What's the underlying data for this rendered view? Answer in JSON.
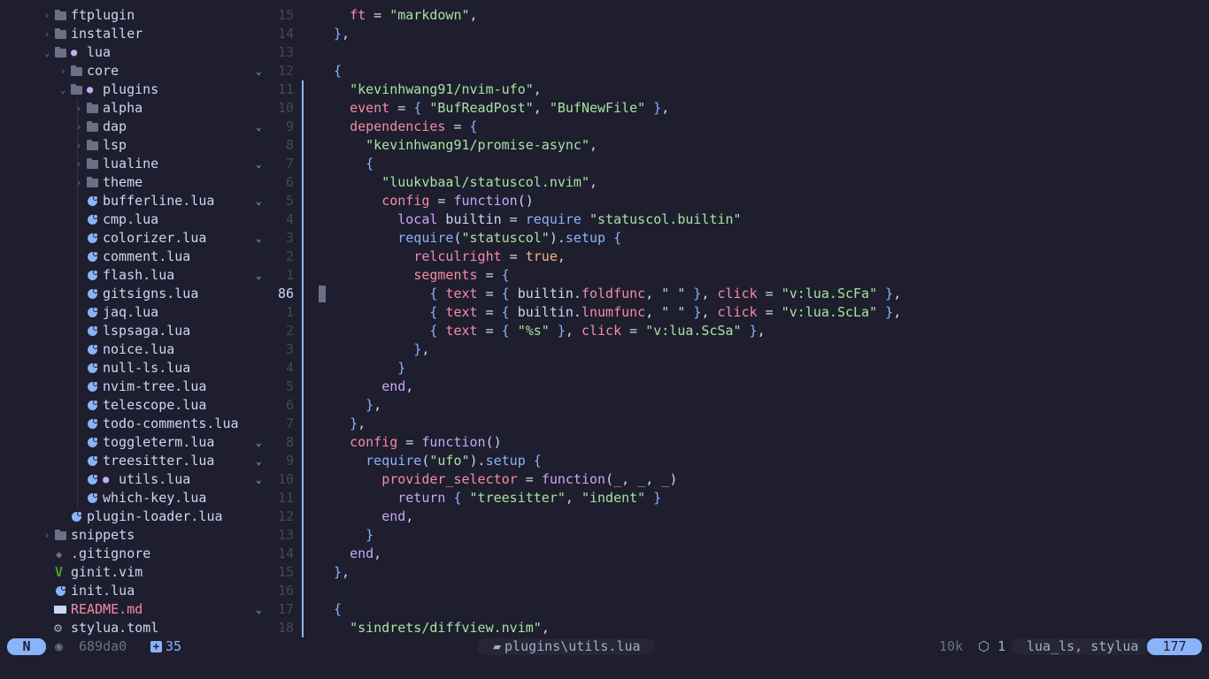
{
  "tree": [
    {
      "name": "ftplugin",
      "type": "folder",
      "depth": 0,
      "open": false,
      "ln": "15"
    },
    {
      "name": "installer",
      "type": "folder",
      "depth": 0,
      "open": false,
      "ln": "14"
    },
    {
      "name": "lua",
      "type": "folder",
      "depth": 0,
      "open": true,
      "modified": true,
      "ln": "13"
    },
    {
      "name": "core",
      "type": "folder",
      "depth": 1,
      "open": false,
      "fold": true,
      "ln": "12"
    },
    {
      "name": "plugins",
      "type": "folder",
      "depth": 1,
      "open": true,
      "modified": true,
      "ln": "11"
    },
    {
      "name": "alpha",
      "type": "folder",
      "depth": 2,
      "open": false,
      "ln": "10"
    },
    {
      "name": "dap",
      "type": "folder",
      "depth": 2,
      "open": false,
      "fold": true,
      "ln": "9"
    },
    {
      "name": "lsp",
      "type": "folder",
      "depth": 2,
      "open": false,
      "ln": "8"
    },
    {
      "name": "lualine",
      "type": "folder",
      "depth": 2,
      "open": false,
      "fold": true,
      "ln": "7"
    },
    {
      "name": "theme",
      "type": "folder",
      "depth": 2,
      "open": false,
      "ln": "6"
    },
    {
      "name": "bufferline.lua",
      "type": "lua",
      "depth": 2,
      "fold": true,
      "ln": "5"
    },
    {
      "name": "cmp.lua",
      "type": "lua",
      "depth": 2,
      "ln": "4"
    },
    {
      "name": "colorizer.lua",
      "type": "lua",
      "depth": 2,
      "fold": true,
      "ln": "3"
    },
    {
      "name": "comment.lua",
      "type": "lua",
      "depth": 2,
      "ln": "2"
    },
    {
      "name": "flash.lua",
      "type": "lua",
      "depth": 2,
      "fold": true,
      "ln": "1"
    },
    {
      "name": "gitsigns.lua",
      "type": "lua",
      "depth": 2,
      "ln": "86",
      "current": true
    },
    {
      "name": "jaq.lua",
      "type": "lua",
      "depth": 2,
      "ln": "1"
    },
    {
      "name": "lspsaga.lua",
      "type": "lua",
      "depth": 2,
      "ln": "2"
    },
    {
      "name": "noice.lua",
      "type": "lua",
      "depth": 2,
      "ln": "3"
    },
    {
      "name": "null-ls.lua",
      "type": "lua",
      "depth": 2,
      "ln": "4"
    },
    {
      "name": "nvim-tree.lua",
      "type": "lua",
      "depth": 2,
      "ln": "5"
    },
    {
      "name": "telescope.lua",
      "type": "lua",
      "depth": 2,
      "ln": "6"
    },
    {
      "name": "todo-comments.lua",
      "type": "lua",
      "depth": 2,
      "ln": "7"
    },
    {
      "name": "toggleterm.lua",
      "type": "lua",
      "depth": 2,
      "fold": true,
      "ln": "8"
    },
    {
      "name": "treesitter.lua",
      "type": "lua",
      "depth": 2,
      "fold": true,
      "ln": "9"
    },
    {
      "name": "utils.lua",
      "type": "lua",
      "depth": 2,
      "modified": true,
      "fold": true,
      "ln": "10"
    },
    {
      "name": "which-key.lua",
      "type": "lua",
      "depth": 2,
      "ln": "11"
    },
    {
      "name": "plugin-loader.lua",
      "type": "lua",
      "depth": 1,
      "ln": "12"
    },
    {
      "name": "snippets",
      "type": "folder",
      "depth": 0,
      "open": false,
      "ln": "13"
    },
    {
      "name": ".gitignore",
      "type": "git",
      "depth": 0,
      "ln": "14"
    },
    {
      "name": "ginit.vim",
      "type": "vim",
      "depth": 0,
      "ln": "15"
    },
    {
      "name": "init.lua",
      "type": "lua",
      "depth": 0,
      "ln": "16"
    },
    {
      "name": "README.md",
      "type": "md",
      "depth": 0,
      "fold": true,
      "ln": "17"
    },
    {
      "name": "stylua.toml",
      "type": "toml",
      "depth": 0,
      "ln": "18"
    }
  ],
  "code": [
    [
      [
        "  ",
        "p"
      ],
      [
        "ft",
        "k"
      ],
      [
        " = ",
        "p"
      ],
      [
        "\"markdown\"",
        "s"
      ],
      [
        ",",
        "p"
      ]
    ],
    [
      [
        "}",
        "b"
      ],
      [
        ",",
        "p"
      ]
    ],
    [],
    [
      [
        "{",
        "b"
      ]
    ],
    [
      [
        "  ",
        "p"
      ],
      [
        "\"kevinhwang91/nvim-ufo\"",
        "s"
      ],
      [
        ",",
        "p"
      ]
    ],
    [
      [
        "  ",
        "p"
      ],
      [
        "event",
        "k"
      ],
      [
        " = ",
        "p"
      ],
      [
        "{",
        "b"
      ],
      [
        " ",
        "p"
      ],
      [
        "\"BufReadPost\"",
        "s"
      ],
      [
        ", ",
        "p"
      ],
      [
        "\"BufNewFile\"",
        "s"
      ],
      [
        " ",
        "p"
      ],
      [
        "}",
        "b"
      ],
      [
        ",",
        "p"
      ]
    ],
    [
      [
        "  ",
        "p"
      ],
      [
        "dependencies",
        "k"
      ],
      [
        " = ",
        "p"
      ],
      [
        "{",
        "b"
      ]
    ],
    [
      [
        "    ",
        "p"
      ],
      [
        "\"kevinhwang91/promise-async\"",
        "s"
      ],
      [
        ",",
        "p"
      ]
    ],
    [
      [
        "    ",
        "p"
      ],
      [
        "{",
        "b"
      ]
    ],
    [
      [
        "      ",
        "p"
      ],
      [
        "\"luukvbaal/statuscol.nvim\"",
        "s"
      ],
      [
        ",",
        "p"
      ]
    ],
    [
      [
        "      ",
        "p"
      ],
      [
        "config",
        "k"
      ],
      [
        " = ",
        "p"
      ],
      [
        "function",
        "kw"
      ],
      [
        "()",
        "p"
      ]
    ],
    [
      [
        "        ",
        "p"
      ],
      [
        "local",
        "kw"
      ],
      [
        " builtin = ",
        "p"
      ],
      [
        "require",
        "fn"
      ],
      [
        " ",
        "p"
      ],
      [
        "\"statuscol.builtin\"",
        "s"
      ]
    ],
    [
      [
        "        ",
        "p"
      ],
      [
        "require",
        "fn"
      ],
      [
        "(",
        "p"
      ],
      [
        "\"statuscol\"",
        "s"
      ],
      [
        ").",
        "p"
      ],
      [
        "setup",
        "fn"
      ],
      [
        " ",
        "p"
      ],
      [
        "{",
        "b"
      ]
    ],
    [
      [
        "          ",
        "p"
      ],
      [
        "relculright",
        "k"
      ],
      [
        " = ",
        "p"
      ],
      [
        "true",
        "bo"
      ],
      [
        ",",
        "p"
      ]
    ],
    [
      [
        "          ",
        "p"
      ],
      [
        "segments",
        "k"
      ],
      [
        " = ",
        "p"
      ],
      [
        "{",
        "b"
      ]
    ],
    [
      [
        "            ",
        "p"
      ],
      [
        "{",
        "b"
      ],
      [
        " ",
        "p"
      ],
      [
        "text",
        "k"
      ],
      [
        " = ",
        "p"
      ],
      [
        "{",
        "b"
      ],
      [
        " builtin.",
        "p"
      ],
      [
        "foldfunc",
        "k"
      ],
      [
        ", ",
        "p"
      ],
      [
        "\" \"",
        "s"
      ],
      [
        " ",
        "p"
      ],
      [
        "}",
        "b"
      ],
      [
        ", ",
        "p"
      ],
      [
        "click",
        "k"
      ],
      [
        " = ",
        "p"
      ],
      [
        "\"v:lua.ScFa\"",
        "s"
      ],
      [
        " ",
        "p"
      ],
      [
        "}",
        "b"
      ],
      [
        ",",
        "p"
      ]
    ],
    [
      [
        "            ",
        "p"
      ],
      [
        "{",
        "b"
      ],
      [
        " ",
        "p"
      ],
      [
        "text",
        "k"
      ],
      [
        " = ",
        "p"
      ],
      [
        "{",
        "b"
      ],
      [
        " builtin.",
        "p"
      ],
      [
        "lnumfunc",
        "k"
      ],
      [
        ", ",
        "p"
      ],
      [
        "\" \"",
        "s"
      ],
      [
        " ",
        "p"
      ],
      [
        "}",
        "b"
      ],
      [
        ", ",
        "p"
      ],
      [
        "click",
        "k"
      ],
      [
        " = ",
        "p"
      ],
      [
        "\"v:lua.ScLa\"",
        "s"
      ],
      [
        " ",
        "p"
      ],
      [
        "}",
        "b"
      ],
      [
        ",",
        "p"
      ]
    ],
    [
      [
        "            ",
        "p"
      ],
      [
        "{",
        "b"
      ],
      [
        " ",
        "p"
      ],
      [
        "text",
        "k"
      ],
      [
        " = ",
        "p"
      ],
      [
        "{",
        "b"
      ],
      [
        " ",
        "p"
      ],
      [
        "\"%s\"",
        "s"
      ],
      [
        " ",
        "p"
      ],
      [
        "}",
        "b"
      ],
      [
        ", ",
        "p"
      ],
      [
        "click",
        "k"
      ],
      [
        " = ",
        "p"
      ],
      [
        "\"v:lua.ScSa\"",
        "s"
      ],
      [
        " ",
        "p"
      ],
      [
        "}",
        "b"
      ],
      [
        ",",
        "p"
      ]
    ],
    [
      [
        "          ",
        "p"
      ],
      [
        "}",
        "b"
      ],
      [
        ",",
        "p"
      ]
    ],
    [
      [
        "        ",
        "p"
      ],
      [
        "}",
        "b"
      ]
    ],
    [
      [
        "      ",
        "p"
      ],
      [
        "end",
        "kw"
      ],
      [
        ",",
        "p"
      ]
    ],
    [
      [
        "    ",
        "p"
      ],
      [
        "}",
        "b"
      ],
      [
        ",",
        "p"
      ]
    ],
    [
      [
        "  ",
        "p"
      ],
      [
        "}",
        "b"
      ],
      [
        ",",
        "p"
      ]
    ],
    [
      [
        "  ",
        "p"
      ],
      [
        "config",
        "k"
      ],
      [
        " = ",
        "p"
      ],
      [
        "function",
        "kw"
      ],
      [
        "()",
        "p"
      ]
    ],
    [
      [
        "    ",
        "p"
      ],
      [
        "require",
        "fn"
      ],
      [
        "(",
        "p"
      ],
      [
        "\"ufo\"",
        "s"
      ],
      [
        ").",
        "p"
      ],
      [
        "setup",
        "fn"
      ],
      [
        " ",
        "p"
      ],
      [
        "{",
        "b"
      ]
    ],
    [
      [
        "      ",
        "p"
      ],
      [
        "provider_selector",
        "k"
      ],
      [
        " = ",
        "p"
      ],
      [
        "function",
        "kw"
      ],
      [
        "(",
        "p"
      ],
      [
        "_",
        "k"
      ],
      [
        ", ",
        "p"
      ],
      [
        "_",
        "k"
      ],
      [
        ", ",
        "p"
      ],
      [
        "_",
        "k"
      ],
      [
        ")",
        "p"
      ]
    ],
    [
      [
        "        ",
        "p"
      ],
      [
        "return",
        "kw"
      ],
      [
        " ",
        "p"
      ],
      [
        "{",
        "b"
      ],
      [
        " ",
        "p"
      ],
      [
        "\"treesitter\"",
        "s"
      ],
      [
        ", ",
        "p"
      ],
      [
        "\"indent\"",
        "s"
      ],
      [
        " ",
        "p"
      ],
      [
        "}",
        "b"
      ]
    ],
    [
      [
        "      ",
        "p"
      ],
      [
        "end",
        "kw"
      ],
      [
        ",",
        "p"
      ]
    ],
    [
      [
        "    ",
        "p"
      ],
      [
        "}",
        "b"
      ]
    ],
    [
      [
        "  ",
        "p"
      ],
      [
        "end",
        "kw"
      ],
      [
        ",",
        "p"
      ]
    ],
    [
      [
        "}",
        "b"
      ],
      [
        ",",
        "p"
      ]
    ],
    [],
    [
      [
        "{",
        "b"
      ]
    ],
    [
      [
        "  ",
        "p"
      ],
      [
        "\"sindrets/diffview.nvim\"",
        "s"
      ],
      [
        ",",
        "p"
      ]
    ]
  ],
  "status": {
    "mode": "N",
    "github_icon": "github-icon",
    "commit": "689da0",
    "added_icon": "+",
    "added": "35",
    "file_icon": "folder-icon",
    "file": "plugins\\utils.lua",
    "size": "10k",
    "diag_icon": "cube-icon",
    "diag": "1",
    "lsp": "lua_ls, stylua",
    "lines": "177"
  },
  "colors": {
    "accent": "#89b4fa",
    "background": "#1e1e2e",
    "string": "#a6e3a1",
    "key": "#f38ba8",
    "keyword": "#cba6f7"
  }
}
